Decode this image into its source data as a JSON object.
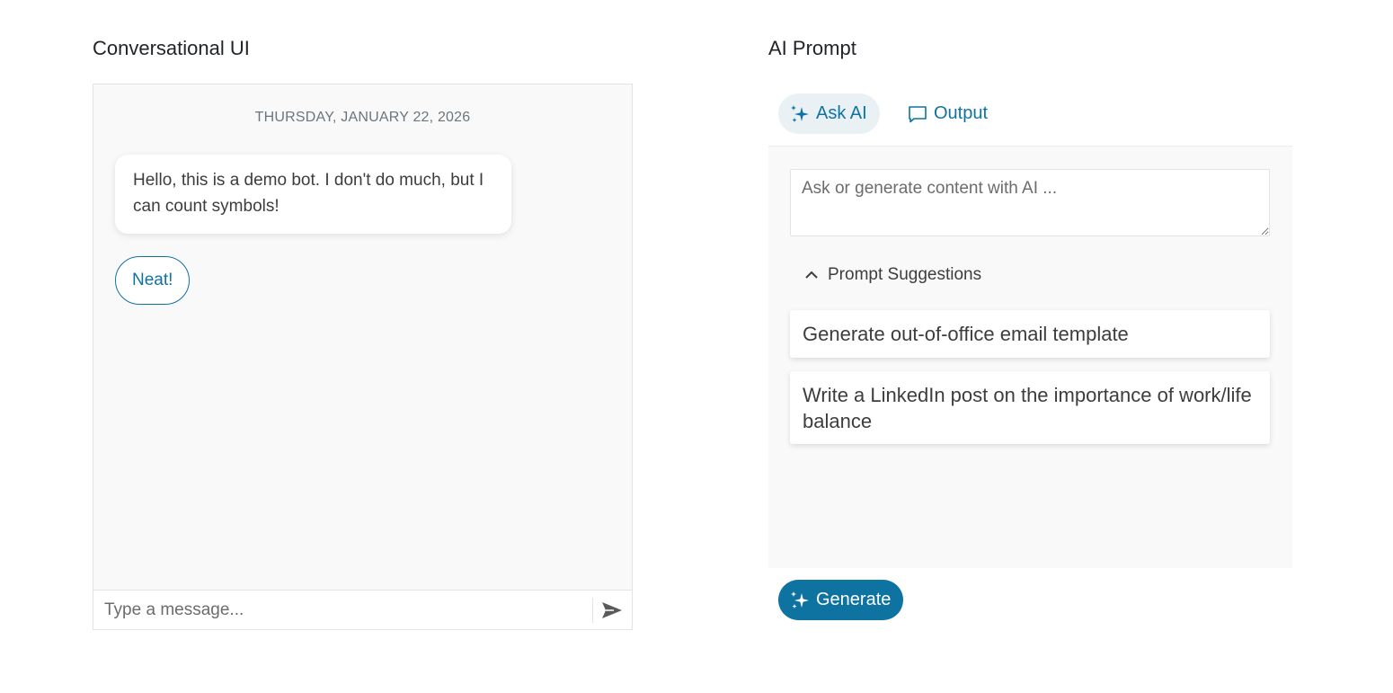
{
  "sections": {
    "conversational_title": "Conversational UI",
    "ai_prompt_title": "AI Prompt"
  },
  "chat": {
    "date_header": "THURSDAY, JANUARY 22, 2026",
    "bot_message": "Hello, this is a demo bot. I don't do much, but I can count symbols!",
    "suggested_action": "Neat!",
    "input_placeholder": "Type a message...",
    "send_icon": "send-icon"
  },
  "ai_prompt": {
    "tabs": [
      {
        "label": "Ask AI",
        "icon": "sparkle-icon",
        "active": true
      },
      {
        "label": "Output",
        "icon": "comment-icon",
        "active": false
      }
    ],
    "textarea_placeholder": "Ask or generate content with AI ...",
    "suggestions_header": "Prompt Suggestions",
    "suggestions": [
      "Generate out-of-office email template",
      "Write a LinkedIn post on the importance of work/life balance"
    ],
    "generate_label": "Generate"
  },
  "colors": {
    "accent": "#0f73a2",
    "active_tab_bg": "#eaf1f5",
    "panel_bg": "#f9f9f9"
  }
}
